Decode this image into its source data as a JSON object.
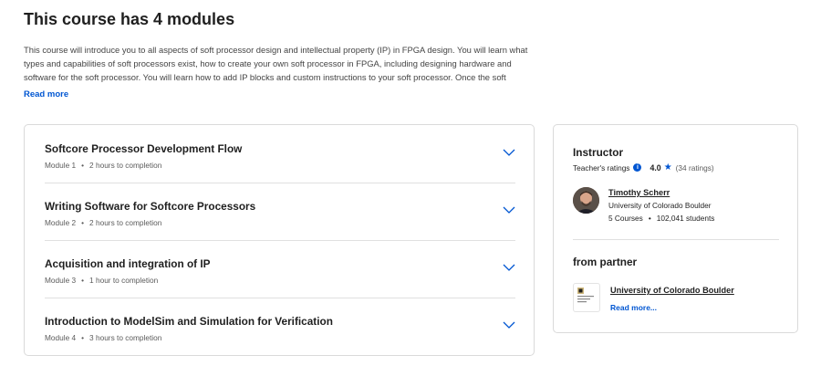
{
  "page_title": "This course has 4 modules",
  "description": {
    "line1": "This course will introduce you to all aspects of soft processor design and intellectual property (IP) in FPGA design. You will learn what",
    "line2": "types and capabilities of soft processors exist, how to create your own soft processor in FPGA, including designing hardware and",
    "line3": "software for the soft processor. You will learn how to add IP blocks and custom instructions to your soft processor. Once the soft"
  },
  "read_more_label": "Read more",
  "modules": [
    {
      "title": "Softcore Processor Development Flow",
      "module_label": "Module 1",
      "duration": "2 hours to completion"
    },
    {
      "title": "Writing Software for Softcore Processors",
      "module_label": "Module 2",
      "duration": "2 hours to completion"
    },
    {
      "title": "Acquisition and integration of IP",
      "module_label": "Module 3",
      "duration": "1 hour to completion"
    },
    {
      "title": "Introduction to ModelSim and Simulation for Verification",
      "module_label": "Module 4",
      "duration": "3 hours to completion"
    }
  ],
  "meta_separator": "•",
  "instructor": {
    "heading": "Instructor",
    "ratings_label": "Teacher's ratings",
    "rating_value": "4.0",
    "rating_count": "(34 ratings)",
    "name": "Timothy Scherr",
    "org": "University of Colorado Boulder",
    "courses": "5 Courses",
    "students": "102,041 students",
    "icons": {
      "info": "info-icon",
      "star": "star-icon"
    }
  },
  "partner": {
    "heading": "from partner",
    "name": "University of Colorado Boulder",
    "more_label": "Read more..."
  },
  "colors": {
    "accent": "#0056d2",
    "text": "#1f1f1f",
    "border": "#dadada"
  }
}
